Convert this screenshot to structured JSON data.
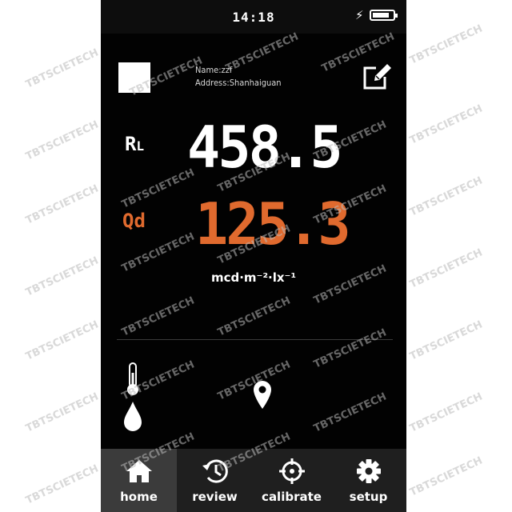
{
  "status_bar": {
    "time": "14:18",
    "battery_level": 0.85,
    "charging_icon": "bolt-icon"
  },
  "profile": {
    "name": "Name:zzf",
    "address": "Address:Shanhaiguan"
  },
  "readings": {
    "rl": {
      "label": "R",
      "label_sub": "L",
      "value": "458.5",
      "color": "#ffffff"
    },
    "qd": {
      "label": "Qd",
      "value": "125.3",
      "color": "#e06a2e"
    },
    "unit": "mcd·m⁻²·lx⁻¹"
  },
  "nav": {
    "tabs": [
      {
        "label": "home",
        "icon": "home-icon",
        "active": true
      },
      {
        "label": "review",
        "icon": "history-icon",
        "active": false
      },
      {
        "label": "calibrate",
        "icon": "crosshair-icon",
        "active": false
      },
      {
        "label": "setup",
        "icon": "gear-icon",
        "active": false
      }
    ]
  },
  "watermark": "TBTSCIETECH",
  "colors": {
    "accent": "#e06a2e",
    "background": "#020202",
    "nav_background": "#1f1f1f",
    "nav_active": "#3b3b3b"
  }
}
